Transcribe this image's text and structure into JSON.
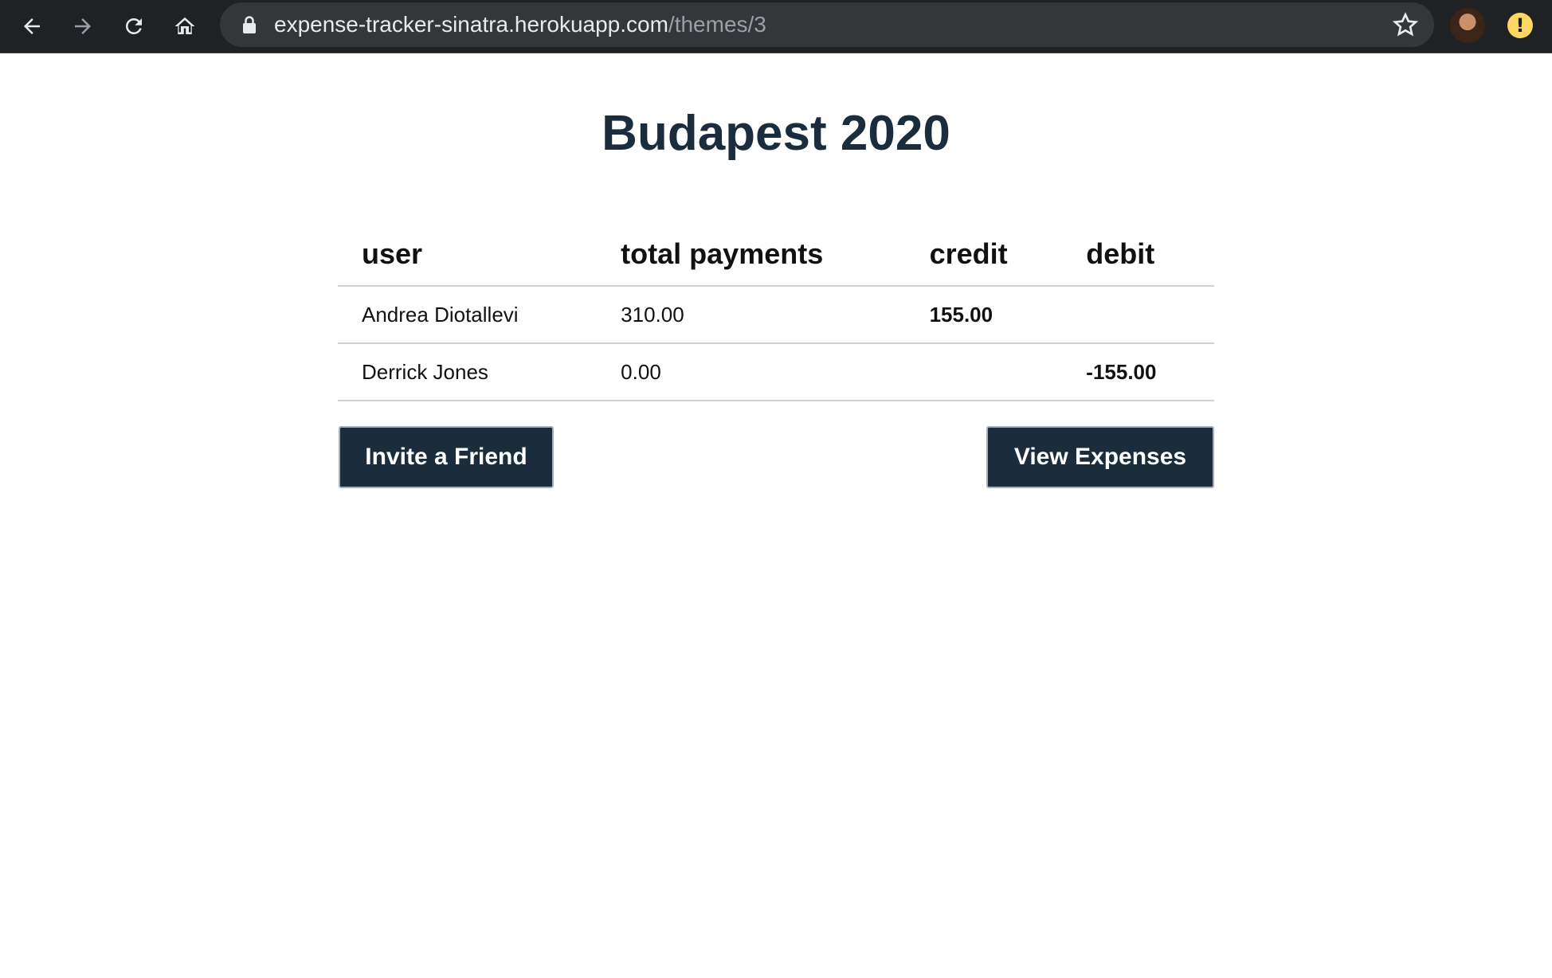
{
  "browser": {
    "url_host": "expense-tracker-sinatra.herokuapp.com",
    "url_path": "/themes/3"
  },
  "page": {
    "title": "Budapest 2020"
  },
  "table": {
    "headers": [
      "user",
      "total payments",
      "credit",
      "debit"
    ],
    "rows": [
      {
        "user": "Andrea Diotallevi",
        "total": "310.00",
        "credit": "155.00",
        "debit": ""
      },
      {
        "user": "Derrick Jones",
        "total": "0.00",
        "credit": "",
        "debit": "-155.00"
      }
    ]
  },
  "actions": {
    "invite_label": "Invite a Friend",
    "view_label": "View Expenses"
  },
  "colors": {
    "primary": "#1b2d3c",
    "credit": "#12851f",
    "debit": "#e8101b"
  }
}
